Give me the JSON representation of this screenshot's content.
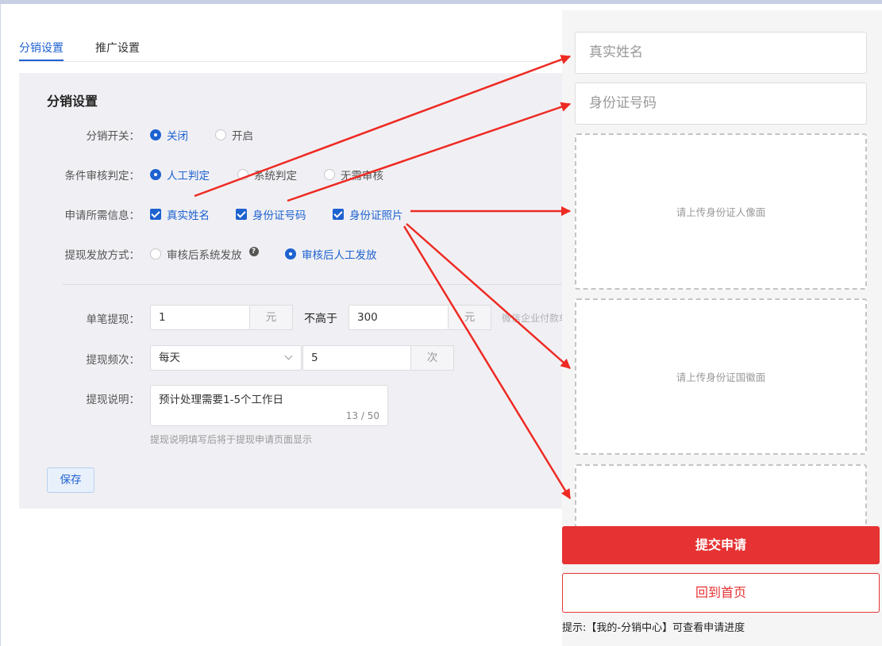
{
  "tabs": [
    {
      "label": "分销设置",
      "active": true
    },
    {
      "label": "推广设置",
      "active": false
    }
  ],
  "card": {
    "title": "分销设置",
    "switch": {
      "label": "分销开关：",
      "options": [
        "关闭",
        "开启"
      ],
      "selected": "关闭"
    },
    "audit": {
      "label": "条件审核判定：",
      "options": [
        "人工判定",
        "系统判定",
        "无需审核"
      ],
      "selected": "人工判定"
    },
    "info": {
      "label": "申请所需信息：",
      "options": [
        "真实姓名",
        "身份证号码",
        "身份证照片"
      ],
      "checked": [
        "真实姓名",
        "身份证号码",
        "身份证照片"
      ]
    },
    "payout": {
      "label": "提现发放方式：",
      "options": [
        "审核后系统发放",
        "审核后人工发放"
      ],
      "selected": "审核后人工发放",
      "help_icon": "question-icon"
    },
    "single": {
      "label": "单笔提现：",
      "min": "1",
      "unit": "元",
      "between": "不高于",
      "max": "300",
      "note": "微信企业付款单"
    },
    "frequency": {
      "label": "提现频次：",
      "period": "每天",
      "count": "5",
      "unit": "次"
    },
    "description": {
      "label": "提现说明：",
      "value": "预计处理需要1-5个工作日",
      "counter": "13 / 50",
      "hint": "提现说明填写后将于提现申请页面显示"
    },
    "save_label": "保存"
  },
  "preview": {
    "name_placeholder": "真实姓名",
    "id_placeholder": "身份证号码",
    "upload_front": "请上传身份证人像面",
    "upload_back": "请上传身份证国徽面",
    "submit_label": "提交申请",
    "home_label": "回到首页",
    "tip": "提示:【我的-分销中心】可查看申请进度"
  },
  "colors": {
    "primary": "#1e62d0",
    "danger": "#e63232",
    "arrow": "#ee2a23"
  }
}
